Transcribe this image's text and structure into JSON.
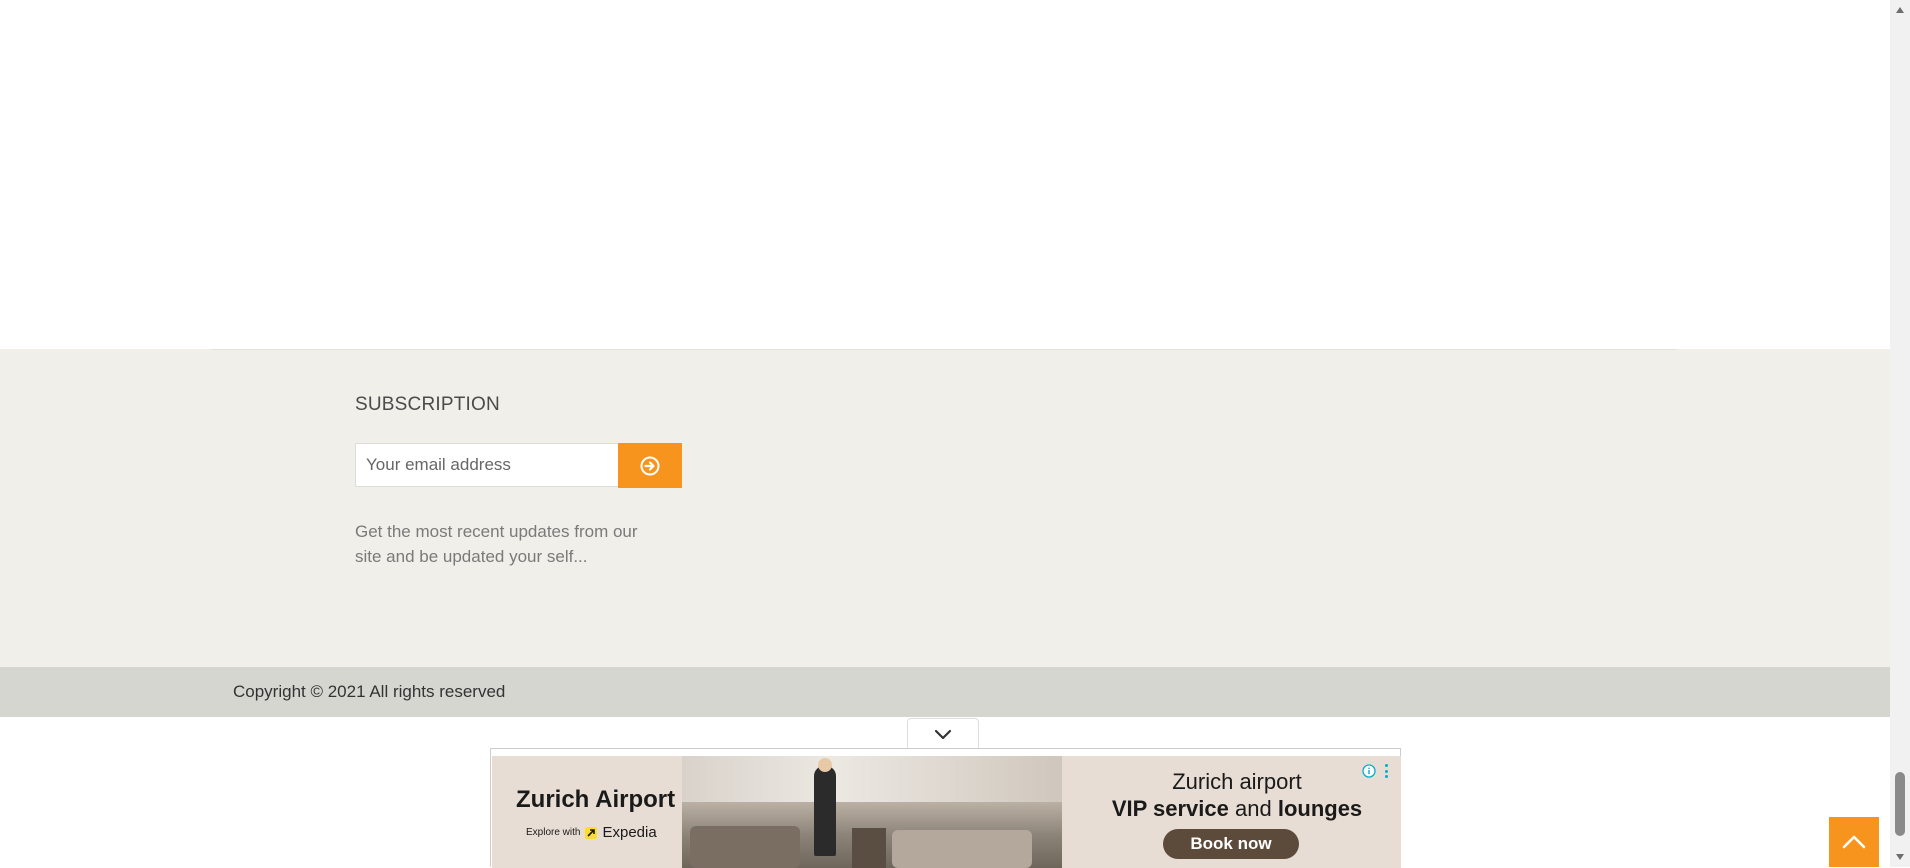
{
  "subscription": {
    "title": "SUBSCRIPTION",
    "email_placeholder": "Your email address",
    "email_value": "",
    "submit_icon": "arrow-circle-right-icon",
    "description": "Get the most recent updates from our site and be updated your self..."
  },
  "footer": {
    "copyright": "Copyright © 2021 All rights reserved"
  },
  "ad": {
    "toggle_icon": "chevron-down-icon",
    "brand": "Zurich Airport",
    "explore_with": "Explore with",
    "expedia": "Expedia",
    "headline_line1": "Zurich airport",
    "headline_bold1": "VIP service",
    "headline_and": "and",
    "headline_bold2": "lounges",
    "cta": "Book now",
    "info_icon": "info-icon",
    "more_icon": "more-vertical-icon"
  },
  "back_to_top": {
    "icon": "chevron-up-icon"
  },
  "colors": {
    "accent": "#f7941d",
    "footer_bg": "#f0efe9",
    "copyright_bg": "#d6d6d1",
    "ad_cta": "#5c4a3b"
  }
}
